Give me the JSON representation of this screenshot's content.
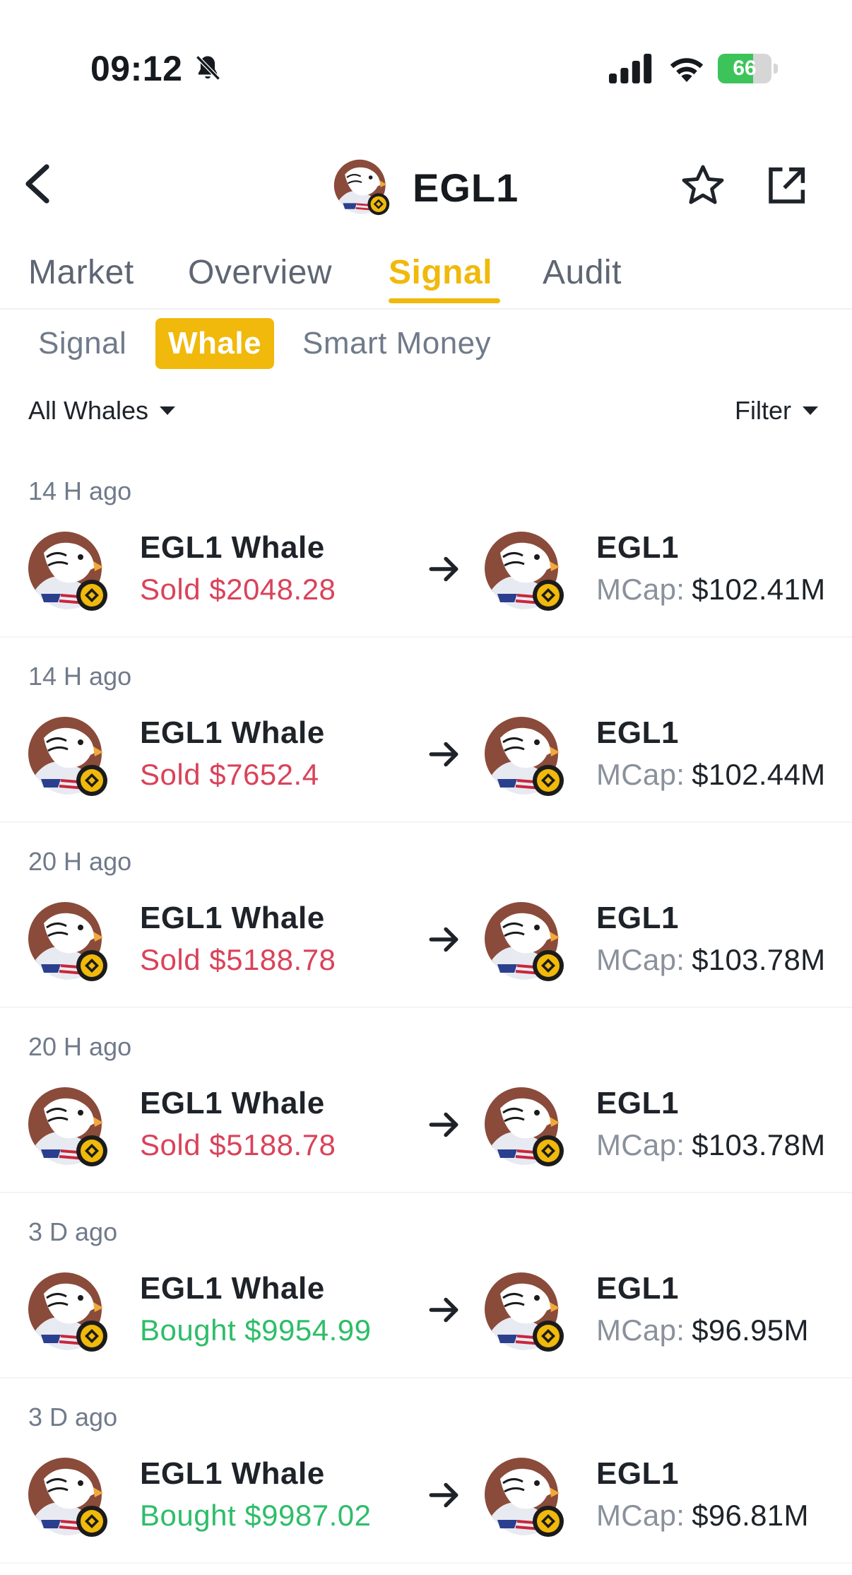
{
  "status_bar": {
    "time": "09:12",
    "battery": "66",
    "battery_level": 0.66,
    "icons": [
      "bell-off-icon",
      "cellular-signal-icon",
      "wifi-icon",
      "battery-charging-icon"
    ]
  },
  "header": {
    "title": "EGL1",
    "icons": [
      "back-icon",
      "egl1-token-logo",
      "star-icon",
      "share-icon"
    ]
  },
  "tabs": [
    {
      "label": "Market",
      "active": false
    },
    {
      "label": "Overview",
      "active": false
    },
    {
      "label": "Signal",
      "active": true
    },
    {
      "label": "Audit",
      "active": false
    }
  ],
  "subtabs": [
    {
      "label": "Signal",
      "active": false
    },
    {
      "label": "Whale",
      "active": true
    },
    {
      "label": "Smart Money",
      "active": false
    }
  ],
  "filters": {
    "whale_filter": "All Whales",
    "filter_label": "Filter"
  },
  "signals": [
    {
      "ago": "14 H ago",
      "name": "EGL1 Whale",
      "action": "Sold",
      "amount": "$2048.28",
      "token": "EGL1",
      "mcap_label": "MCap:",
      "mcap": "$102.41M"
    },
    {
      "ago": "14 H ago",
      "name": "EGL1 Whale",
      "action": "Sold",
      "amount": "$7652.4",
      "token": "EGL1",
      "mcap_label": "MCap:",
      "mcap": "$102.44M"
    },
    {
      "ago": "20 H ago",
      "name": "EGL1 Whale",
      "action": "Sold",
      "amount": "$5188.78",
      "token": "EGL1",
      "mcap_label": "MCap:",
      "mcap": "$103.78M"
    },
    {
      "ago": "20 H ago",
      "name": "EGL1 Whale",
      "action": "Sold",
      "amount": "$5188.78",
      "token": "EGL1",
      "mcap_label": "MCap:",
      "mcap": "$103.78M"
    },
    {
      "ago": "3 D ago",
      "name": "EGL1 Whale",
      "action": "Bought",
      "amount": "$9954.99",
      "token": "EGL1",
      "mcap_label": "MCap:",
      "mcap": "$96.95M"
    },
    {
      "ago": "3 D ago",
      "name": "EGL1 Whale",
      "action": "Bought",
      "amount": "$9987.02",
      "token": "EGL1",
      "mcap_label": "MCap:",
      "mcap": "$96.81M"
    }
  ],
  "colors": {
    "accent": "#f0b90b",
    "sold": "#d9435a",
    "bought": "#2ebd69",
    "muted": "#707a8a"
  }
}
